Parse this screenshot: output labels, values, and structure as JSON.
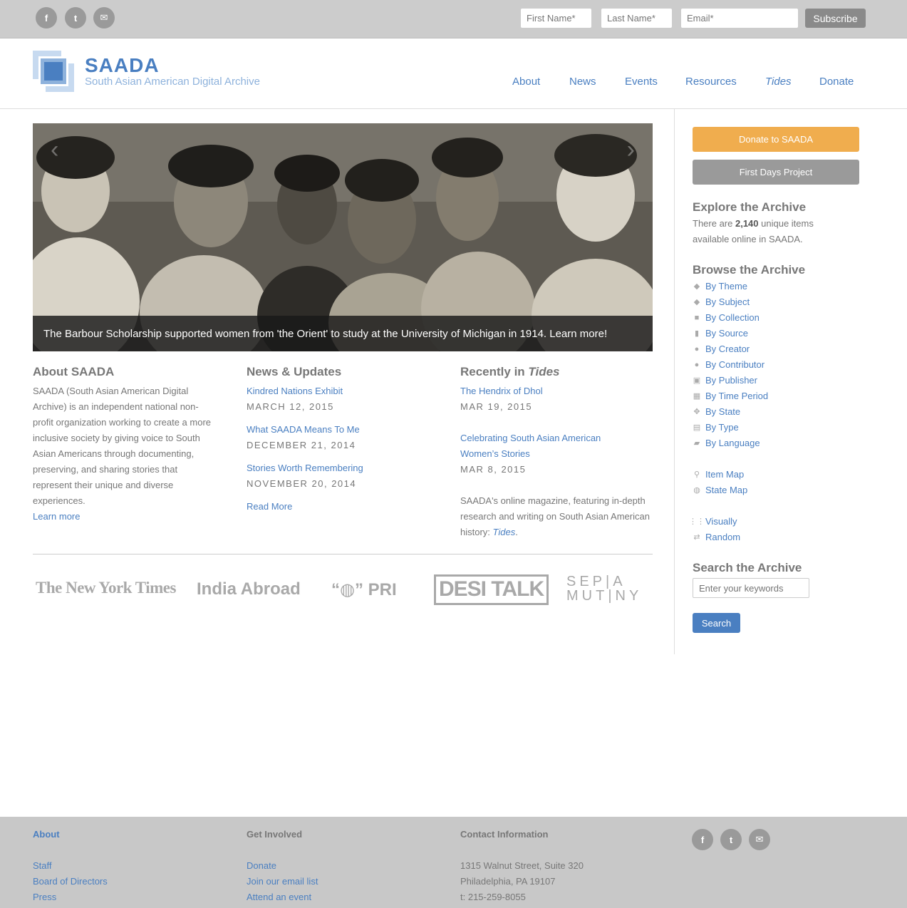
{
  "topbar": {
    "social": [
      "f",
      "t",
      "✉"
    ],
    "first_name_placeholder": "First Name*",
    "last_name_placeholder": "Last Name*",
    "email_placeholder": "Email*",
    "subscribe": "Subscribe"
  },
  "logo": {
    "title": "SAADA",
    "subtitle": "South Asian American Digital Archive"
  },
  "nav": [
    "About",
    "News",
    "Events",
    "Resources",
    "Tides",
    "Donate"
  ],
  "slide": {
    "caption": "The Barbour Scholarship supported women from 'the Orient' to study at the University of Michigan in 1914. Learn more!"
  },
  "about": {
    "heading": "About SAADA",
    "body": "SAADA (South Asian American Digital Archive) is an independent national non-profit organization working to create a more inclusive society by giving voice to South Asian Americans through documenting, preserving, and sharing stories that represent their unique and diverse experiences.",
    "link": "Learn more"
  },
  "news": {
    "heading": "News & Updates",
    "items": [
      {
        "title": "Kindred Nations Exhibit",
        "date": "March 12, 2015"
      },
      {
        "title": "What SAADA Means To Me",
        "date": "December 21, 2014"
      },
      {
        "title": "Stories Worth Remembering",
        "date": "November 20, 2014"
      }
    ],
    "read_more": "Read More"
  },
  "tides": {
    "heading_prefix": "Recently in ",
    "heading_em": "Tides",
    "items": [
      {
        "title": "The Hendrix of Dhol",
        "date": "MAR 19, 2015"
      },
      {
        "title": "Celebrating South Asian American Women’s Stories",
        "date": "MAR 8, 2015"
      }
    ],
    "desc": "SAADA's online magazine, featuring in-depth research and writing on South Asian American history: ",
    "desc_link": "Tides",
    "desc_end": "."
  },
  "press": [
    "The New York Times",
    "India Abroad",
    "“◍” PRI",
    "DESI TALK",
    "SEP|A MUT|NY"
  ],
  "sidebar": {
    "donate": "Donate to SAADA",
    "first_days": "First Days Project",
    "explore_heading": "Explore the Archive",
    "explore_pre": "There are ",
    "explore_count": "2,140",
    "explore_post": " unique items available online in SAADA.",
    "browse_heading": "Browse the Archive",
    "browse": [
      {
        "icon": "tag-icon",
        "label": "By Theme"
      },
      {
        "icon": "tag-icon",
        "label": "By Subject"
      },
      {
        "icon": "briefcase-icon",
        "label": "By Collection"
      },
      {
        "icon": "book-icon",
        "label": "By Source"
      },
      {
        "icon": "user-icon",
        "label": "By Creator"
      },
      {
        "icon": "user-icon",
        "label": "By Contributor"
      },
      {
        "icon": "print-icon",
        "label": "By Publisher"
      },
      {
        "icon": "calendar-icon",
        "label": "By Time Period"
      },
      {
        "icon": "compass-icon",
        "label": "By State"
      },
      {
        "icon": "film-icon",
        "label": "By Type"
      },
      {
        "icon": "comment-icon",
        "label": "By Language"
      }
    ],
    "maps": [
      {
        "icon": "map-marker-icon",
        "label": "Item Map"
      },
      {
        "icon": "globe-icon",
        "label": "State Map"
      }
    ],
    "other": [
      {
        "icon": "grid-icon",
        "label": "Visually"
      },
      {
        "icon": "retweet-icon",
        "label": "Random"
      }
    ],
    "search_heading": "Search the Archive",
    "search_placeholder": "Enter your keywords",
    "search_button": "Search"
  },
  "footer": {
    "about_heading": "About",
    "about_links": [
      "Staff",
      "Board of Directors",
      "Press"
    ],
    "involved_heading": "Get Involved",
    "involved_links": [
      "Donate",
      "Join our email list",
      "Attend an event"
    ],
    "contact_heading": "Contact Information",
    "contact_lines": [
      "1315 Walnut Street, Suite 320",
      "Philadelphia, PA 19107",
      "t: 215-259-8055"
    ]
  },
  "colors": {
    "accent": "#4a7fc1",
    "donate": "#f0ad4e",
    "gray_button": "#9a9a9a",
    "topbar": "#cccccc",
    "footer": "#c8c8c8"
  }
}
